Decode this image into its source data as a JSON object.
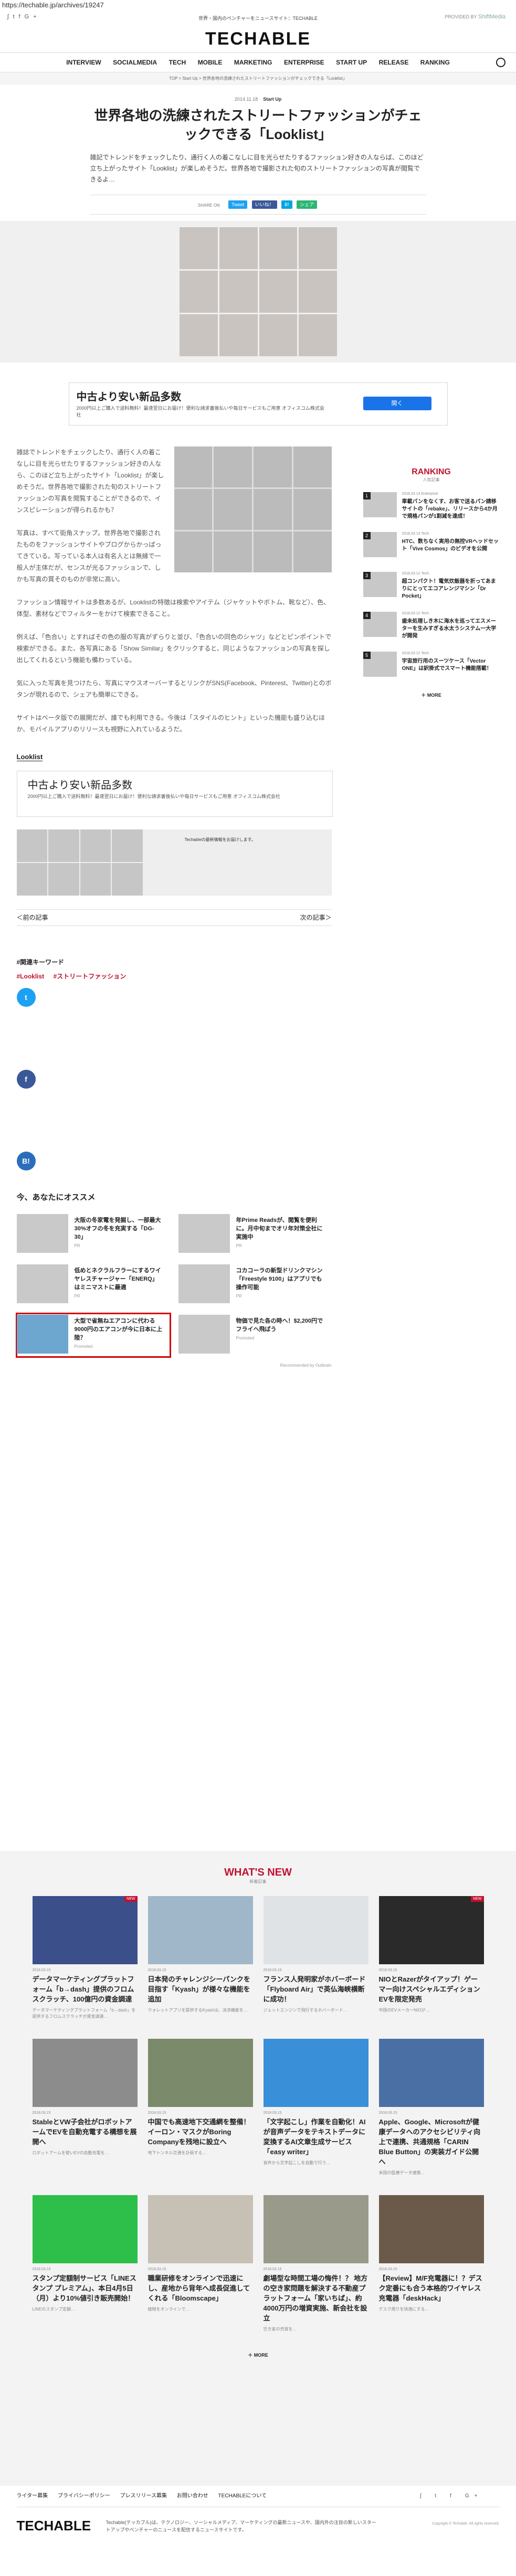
{
  "url": "https://techable.jp/archives/19247",
  "header": {
    "social": [
      "rss",
      "twitter",
      "facebook",
      "g+"
    ],
    "tagline": "世界・国内のベンチャーをニュースサイト：TECHABLE",
    "ext_label": "PROVIDED BY",
    "ext_brand": "ShiftMedia",
    "logo": "TECHABLE",
    "nav": [
      "INTERVIEW",
      "SOCIALMEDIA",
      "TECH",
      "MOBILE",
      "MARKETING",
      "ENTERPRISE",
      "START UP",
      "RELEASE",
      "RANKING"
    ]
  },
  "breadcrumb": "TOP  >  Start Up  >  世界各地の洗練されたストリートファッションがチェックできる「Looklist」",
  "article": {
    "date": "2014.11.18",
    "category": "Start Up",
    "title": "世界各地の洗練されたストリートファッションがチェックできる「Looklist」",
    "lead": "雑記でトレンドをチェックしたり、通行く人の着こなしに目を光らせたりするファッション好きの人ならば、このほど立ち上がったサイト「Looklist」が楽しめそうだ。世界各地で撮影された旬のストリートファッションの写真が閲覧できるよ…",
    "share_label": "SHARE ON",
    "share_buttons": [
      "Tweet",
      "いいね！",
      "B!",
      "シェア"
    ],
    "paragraphs": [
      "雑誌でトレンドをチェックしたり、通行く人の着こなしに目を光らせたりするファッション好きの人なら、このほど立ち上がったサイト「Looklist」が楽しめそうだ。世界各地で撮影された旬のストリートファッションの写真を閲覧することができるので、インスピレーションが得られるかも？",
      "写真は、すべて街角スナップ。世界各地で撮影されたものをファッションサイトやブログからかっぱってきている。写っている本人は有名人とは無縁で一般人が主体だが、センスが光るファッションで、しかも写真の質そのものが非常に高い。",
      "ファッション情報サイトは多数あるが、Looklistの特徴は検索やアイテム（ジャケットやボトム、靴など）、色、体型、素材などでフィルターをかけて検索できること。",
      "例えば、「色合い」とすればその色の服の写真がずらりと並び、「色合いの同色のシャツ」などとピンポイントで検索ができる。また、各写真にある「Show Similar」をクリックすると、同じようなファッションの写真を探し出してくれるという機能も備わっている。",
      "気に入った写真を見つけたら、写真にマウスオーバーするとリンクがSNS(Facebook、Pinterest、Twitter)とのボタンが現れるので、シェアも簡単にできる。",
      "サイトはベータ版での展開だが、誰でも利用できる。今後は「スタイルのヒント」といった機能も盛り込むほか、モバイルアプリのリリースも視野に入れているようだ。"
    ],
    "source_heading": "Looklist",
    "embed_text": "Techableの最新情報をお届けします。",
    "prev": "＜前の記事",
    "next": "次の記事＞"
  },
  "ads": {
    "title": "中古より安い新品多数",
    "desc": "2000円以上ご購入で送料無料！最速翌日にお届け！便利な請求書後払いや毎日サービスもご用意 オフィスコム株式会社",
    "cta": "開く"
  },
  "keywords": {
    "title": "#関連キーワード",
    "items": [
      "#Looklist",
      "#ストリートファッション"
    ]
  },
  "recommend": {
    "title": "今、あなたにオススメ",
    "items": [
      {
        "text": "大阪の冬家電を発掘し、一部最大30%オフの冬を充実する「DG-30」",
        "src": "PR"
      },
      {
        "text": "年Prime Readsが、閲覧を便利に。月中旬までオリ年対策全社に実施中",
        "src": "PR"
      },
      {
        "text": "低めとネクラルフラーにするワイヤレスチャージャー「ENERQ」はミニマストに最適",
        "src": "PR"
      },
      {
        "text": "コカコーラの新型ドリンクマシン「Freestyle 9100」はアプリでも操作可能",
        "src": "PR"
      },
      {
        "text": "大型で省無ねエアコンに代わる9000円のエアコンが今に日本に上陸？",
        "src": "Promoted"
      },
      {
        "text": "物価で見た各の時へ！$2,200円でフライヘ飛ばう",
        "src": "Promoted"
      }
    ],
    "footer": "Recommended by Outbrain"
  },
  "ranking": {
    "title": "RANKING",
    "sub": "人気記事",
    "items": [
      {
        "rank": "1",
        "date": "2018.03.14 Enterprise",
        "text": "車載バンをなくす、お客で送るパン請移サイトの「rebake」、リリースから4か月で規格パンが1割減を達成！"
      },
      {
        "rank": "2",
        "date": "2018.03.13 Tech",
        "text": "HTC、数ちなく実用の無控VRヘッドセット「Vive Cosmos」のビデオを公開"
      },
      {
        "rank": "3",
        "date": "2018.03.12 Tech",
        "text": "超コンパクト！電気炊飯器を折ってあまりにとってエコアレンジマシン「Dr Pocket」"
      },
      {
        "rank": "4",
        "date": "2018.03.12 Tech",
        "text": "歯未処理しき木に海水を巡ってエスメーターを生みすぎる水太うシステム一大学が開発"
      },
      {
        "rank": "5",
        "date": "2018.03.12 Tech",
        "text": "宇宙旅行用のスーツケース「Vector ONE」は訳掛式でスマート機能搭載！"
      }
    ],
    "more": "＋ MORE"
  },
  "whatsnew": {
    "title": "WHAT'S NEW",
    "sub": "新着記事",
    "items": [
      {
        "date": "2018.03.15",
        "text": "データマーケティングプラットフォーム「b→dash」提供のフロムスクラッチ、100億円の資金調達",
        "excerpt": "データマーケティングプラットフォーム「b→dash」を提供するフロムスクラッチが資金調達…"
      },
      {
        "date": "2018.03.15",
        "text": "日本発のチャレンジシーパンクを目指す「Kyash」が様々な機能を追加",
        "excerpt": "ウォレットアプリを提供するKyashは、決済機能を…"
      },
      {
        "date": "2018.03.15",
        "text": "フランス人発明家がホバーボード「Flyboard Air」で英仏海峡横断に成功！",
        "excerpt": "ジェットエンジンで飛行するホバーボード…"
      },
      {
        "date": "2018.03.15",
        "text": "NIOとRazerがタイアップ！ゲーマー向けスペシャルエディションEVを限定発売",
        "excerpt": "中国のEVメーカーNIOが…"
      },
      {
        "date": "2018.03.15",
        "text": "StableとVW子会社がロボットアームでEVを自動充電する構想を展開へ",
        "excerpt": "ロボットアームを使いEVの自動充電を…"
      },
      {
        "date": "2018.03.15",
        "text": "中国でも高速地下交通網を整備！イーロン・マスクがBoring Companyを残地に設立へ",
        "excerpt": "地下トンネル交通を計画する…"
      },
      {
        "date": "2018.03.15",
        "text": "「文字起こし」作業を自動化！AIが音声データをテキストデータに変換するAI文章生成サービス「easy writer」",
        "excerpt": "音声から文字起こしを自動で行う…"
      },
      {
        "date": "2018.03.15",
        "text": "Apple、Google、Microsoftが健康データへのアクセシビリティ向上で連携、共通規格「CARIN Blue Button」の実装ガイド公開へ",
        "excerpt": "米国の医療データ連携…"
      },
      {
        "date": "2018.03.15",
        "text": "スタンプ定額制サービス「LINEスタンプ プレミアム」、本日4月5日（月）より10%値引き販売開始！",
        "excerpt": "LINEのスタンプ定額…"
      },
      {
        "date": "2018.03.15",
        "text": "職業研修をオンラインで迅速にし、産地から背年へ成長促進してくれる「Bloomscape」",
        "excerpt": "植物をオンラインで…"
      },
      {
        "date": "2018.03.15",
        "text": "劇場型な時間工場の悔件！？ 地方の空き家問題を解決する不動産プラットフォーム「家いちば」、約4000万円の増資実施、新会社を設立",
        "excerpt": "空き家の売買を…"
      },
      {
        "date": "2018.03.15",
        "text": "【Review】M/F充電器に！？デスク定番にも合う本格的ワイヤレス充電器「deskHack」",
        "excerpt": "デスク周りを快適にする…"
      }
    ],
    "more": "＋ MORE"
  },
  "footer": {
    "links": [
      "ライター募集",
      "プライバシーポリシー",
      "プレスリリース募集",
      "お問い合わせ",
      "TECHABLEについて"
    ],
    "logo": "TECHABLE",
    "desc": "Techable(テッカブル)は、テクノロジー、ソーシャルメディア、マーケティングの最新ニュースや、国内外の注目の新しいスタートアップやベンチャーのニュースを配信するニュースサイトです。",
    "copyright": "Copyright © Techable. All rights reserved."
  }
}
